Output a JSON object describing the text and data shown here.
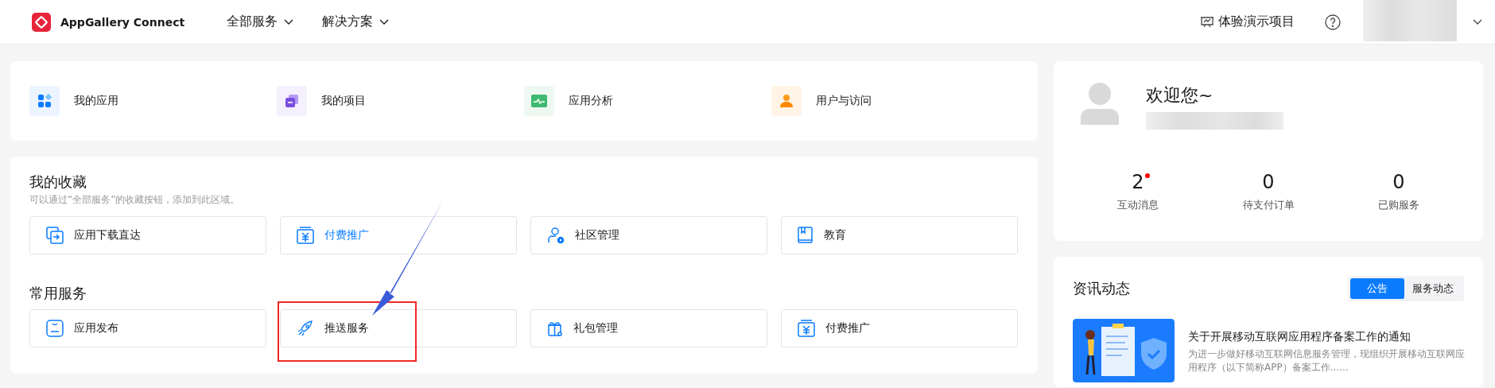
{
  "header": {
    "logo_text": "AppGallery Connect",
    "nav": [
      {
        "label": "全部服务"
      },
      {
        "label": "解决方案"
      }
    ],
    "demo_link": "体验演示项目"
  },
  "quick_links": [
    {
      "label": "我的应用",
      "kind": "apps"
    },
    {
      "label": "我的项目",
      "kind": "projects"
    },
    {
      "label": "应用分析",
      "kind": "analytics"
    },
    {
      "label": "用户与访问",
      "kind": "user"
    }
  ],
  "favorites": {
    "title": "我的收藏",
    "hint": "可以通过“全部服务”的收藏按钮，添加到此区域。",
    "items": [
      {
        "label": "应用下载直达",
        "kind": "download",
        "active": false,
        "annotated": false
      },
      {
        "label": "付费推广",
        "kind": "paid",
        "active": true,
        "annotated": false
      },
      {
        "label": "社区管理",
        "kind": "community",
        "active": false,
        "annotated": false
      },
      {
        "label": "教育",
        "kind": "book",
        "active": false,
        "annotated": false
      }
    ]
  },
  "common_services": {
    "title": "常用服务",
    "items": [
      {
        "label": "应用发布",
        "kind": "publish",
        "active": false,
        "annotated": false
      },
      {
        "label": "推送服务",
        "kind": "rocket",
        "active": false,
        "annotated": true
      },
      {
        "label": "礼包管理",
        "kind": "gift",
        "active": false,
        "annotated": false
      },
      {
        "label": "付费推广",
        "kind": "paid",
        "active": false,
        "annotated": false
      }
    ]
  },
  "profile": {
    "greeting": "欢迎您~",
    "stats": [
      {
        "value": "2",
        "label": "互动消息",
        "unread": true
      },
      {
        "value": "0",
        "label": "待支付订单",
        "unread": false
      },
      {
        "value": "0",
        "label": "已购服务",
        "unread": false
      }
    ]
  },
  "news": {
    "title": "资讯动态",
    "tabs": [
      {
        "label": "公告",
        "selected": true
      },
      {
        "label": "服务动态",
        "selected": false
      }
    ],
    "articles": [
      {
        "headline": "关于开展移动互联网应用程序备案工作的通知",
        "summary": "为进一步做好移动互联网信息服务管理，现组织开展移动互联网应用程序（以下简称APP）备案工作......"
      }
    ]
  }
}
